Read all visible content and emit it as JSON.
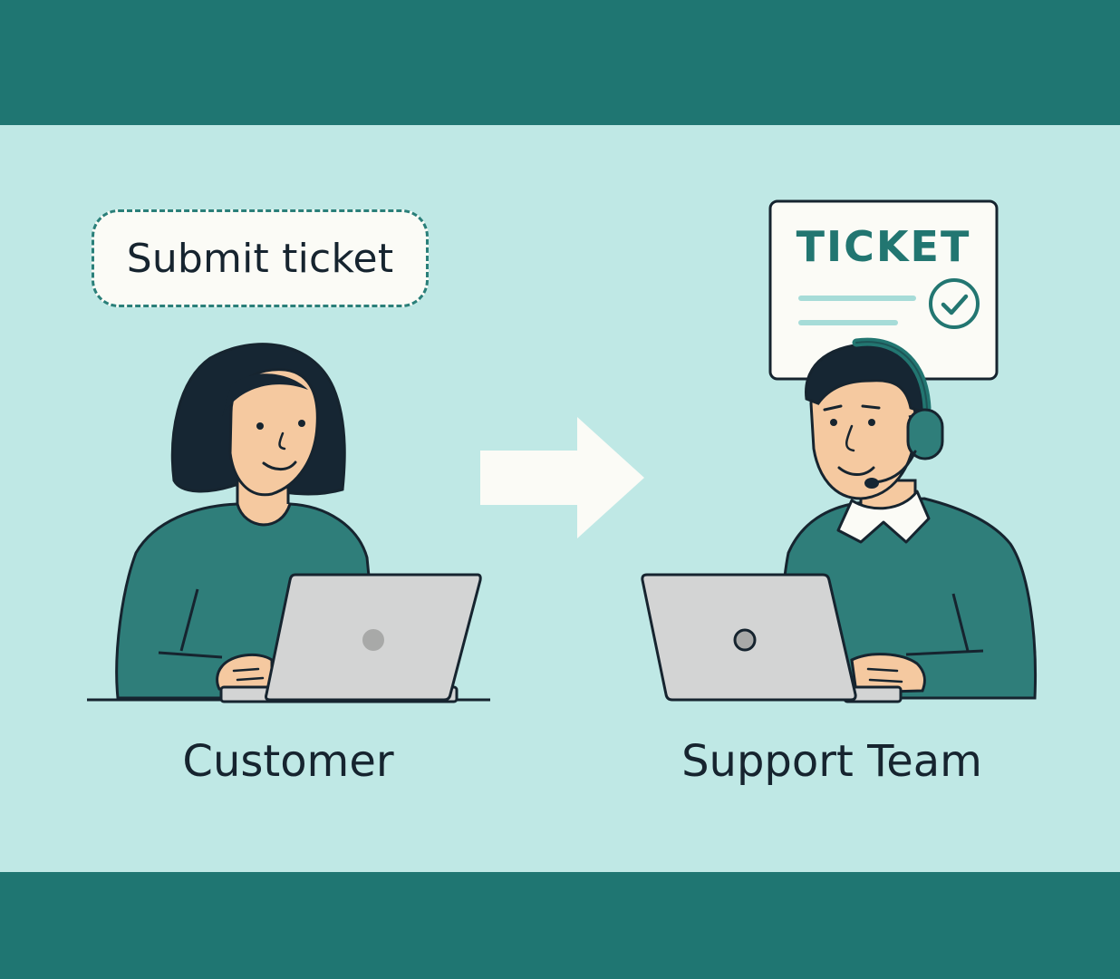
{
  "bubble": {
    "text": "Submit ticket"
  },
  "ticket": {
    "title": "TICKET"
  },
  "labels": {
    "customer": "Customer",
    "support": "Support Team"
  },
  "colors": {
    "band": "#1f7672",
    "background": "#bfe8e5",
    "accent": "#2a7f79",
    "shirt": "#2f7e7a",
    "skin": "#f5c9a0",
    "hair": "#162633",
    "laptop": "#d3d4d4",
    "outline": "#16242f",
    "card": "#fbfbf6"
  },
  "icons": [
    "arrow-right-icon",
    "checkmark-icon",
    "headset-icon",
    "laptop-icon"
  ]
}
